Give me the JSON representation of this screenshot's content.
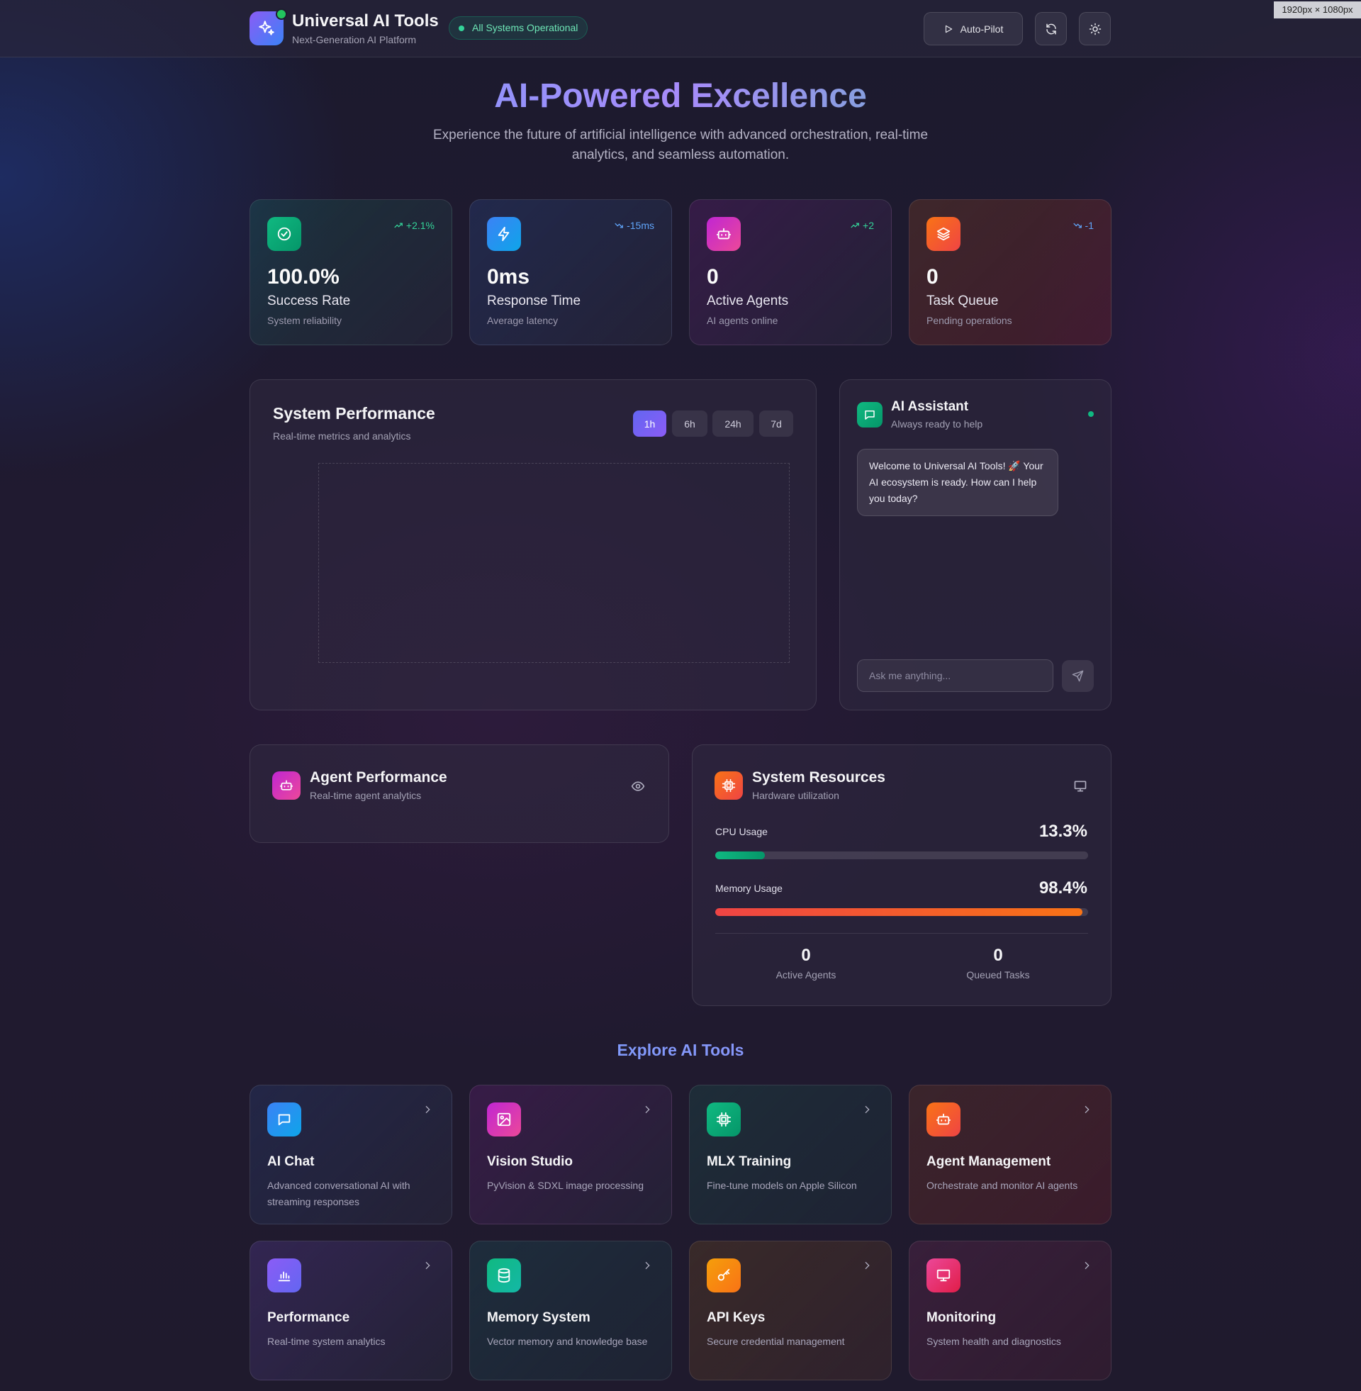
{
  "header": {
    "title": "Universal AI Tools",
    "subtitle": "Next-Generation AI Platform",
    "status": "All Systems Operational",
    "autopilot_label": "Auto-Pilot",
    "dimension_tag": "1920px × 1080px"
  },
  "hero": {
    "title": "AI-Powered Excellence",
    "subtitle": "Experience the future of artificial intelligence with advanced orchestration, real-time analytics, and seamless automation."
  },
  "stats": [
    {
      "value": "100.0%",
      "label": "Success Rate",
      "desc": "System reliability",
      "delta": "+2.1%",
      "icon": "check-circle-icon",
      "color": "#10b981"
    },
    {
      "value": "0ms",
      "label": "Response Time",
      "desc": "Average latency",
      "delta": "-15ms",
      "icon": "lightning-icon",
      "color": "#3b82f6"
    },
    {
      "value": "0",
      "label": "Active Agents",
      "desc": "AI agents online",
      "delta": "+2",
      "icon": "bot-icon",
      "color": "#c026d3"
    },
    {
      "value": "0",
      "label": "Task Queue",
      "desc": "Pending operations",
      "delta": "-1",
      "icon": "layers-icon",
      "color": "#f97316"
    }
  ],
  "performance": {
    "title": "System Performance",
    "subtitle": "Real-time metrics and analytics",
    "ranges": [
      "1h",
      "6h",
      "24h",
      "7d"
    ],
    "active_range": "1h"
  },
  "assistant": {
    "title": "AI Assistant",
    "subtitle": "Always ready to help",
    "welcome": "Welcome to Universal AI Tools! 🚀 Your AI ecosystem is ready. How can I help you today?",
    "placeholder": "Ask me anything..."
  },
  "agent_performance": {
    "title": "Agent Performance",
    "subtitle": "Real-time agent analytics"
  },
  "resources": {
    "title": "System Resources",
    "subtitle": "Hardware utilization",
    "cpu_label": "CPU Usage",
    "cpu_value": "13.3%",
    "cpu_fraction": 0.133,
    "memory_label": "Memory Usage",
    "memory_value": "98.4%",
    "memory_fraction": 0.984,
    "active_agents_value": "0",
    "active_agents_label": "Active Agents",
    "queued_tasks_value": "0",
    "queued_tasks_label": "Queued Tasks"
  },
  "tools": {
    "section_title": "Explore AI Tools",
    "items": [
      {
        "name": "AI Chat",
        "desc": "Advanced conversational AI with streaming responses",
        "icon": "chat-icon"
      },
      {
        "name": "Vision Studio",
        "desc": "PyVision & SDXL image processing",
        "icon": "image-icon"
      },
      {
        "name": "MLX Training",
        "desc": "Fine-tune models on Apple Silicon",
        "icon": "cpu-icon"
      },
      {
        "name": "Agent Management",
        "desc": "Orchestrate and monitor AI agents",
        "icon": "bot-icon"
      },
      {
        "name": "Performance",
        "desc": "Real-time system analytics",
        "icon": "bar-chart-icon"
      },
      {
        "name": "Memory System",
        "desc": "Vector memory and knowledge base",
        "icon": "database-icon"
      },
      {
        "name": "API Keys",
        "desc": "Secure credential management",
        "icon": "key-icon"
      },
      {
        "name": "Monitoring",
        "desc": "System health and diagnostics",
        "icon": "monitor-icon"
      }
    ]
  }
}
